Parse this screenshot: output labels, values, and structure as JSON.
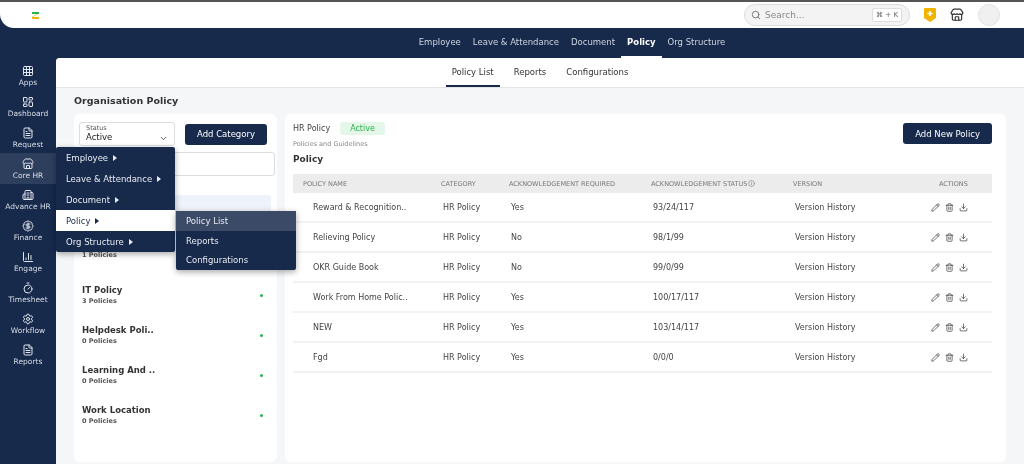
{
  "header": {
    "search": {
      "placeholder": "Search..."
    },
    "shortcut": "⌘ + K"
  },
  "top_nav": [
    {
      "label": "Employee",
      "selected": false
    },
    {
      "label": "Leave & Attendance",
      "selected": false
    },
    {
      "label": "Document",
      "selected": false
    },
    {
      "label": "Policy",
      "selected": true
    },
    {
      "label": "Org Structure",
      "selected": false
    }
  ],
  "sidebar": {
    "items": [
      {
        "kind": "apps",
        "label": "Apps",
        "selected": false
      },
      {
        "kind": "dashboard",
        "label": "Dashboard",
        "selected": false
      },
      {
        "kind": "request",
        "label": "Request",
        "selected": false
      },
      {
        "kind": "corehr",
        "label": "Core HR",
        "selected": true
      },
      {
        "kind": "advancehr",
        "label": "Advance HR",
        "selected": false
      },
      {
        "kind": "finance",
        "label": "Finance",
        "selected": false
      },
      {
        "kind": "engage",
        "label": "Engage",
        "selected": false
      },
      {
        "kind": "timesheet",
        "label": "Timesheet",
        "selected": false
      },
      {
        "kind": "workflow",
        "label": "Workflow",
        "selected": false
      },
      {
        "kind": "reports",
        "label": "Reports",
        "selected": false
      }
    ]
  },
  "sub_tabs": [
    {
      "label": "Policy List",
      "selected": true
    },
    {
      "label": "Reports",
      "selected": false
    },
    {
      "label": "Configurations",
      "selected": false
    }
  ],
  "page_title": "Organisation Policy",
  "categories_panel": {
    "status": {
      "label": "Status",
      "value": "Active"
    },
    "add_button": "Add Category",
    "items": [
      {
        "selected": true
      },
      {
        "count": "1 Policies",
        "selected": false
      },
      {
        "name": "IT Policy",
        "count": "3 Policies",
        "selected": false
      },
      {
        "name": "Helpdesk Poli..",
        "count": "0 Policies",
        "selected": false
      },
      {
        "name": "Learning And ..",
        "count": "0 Policies",
        "selected": false
      },
      {
        "name": "Work Location",
        "count": "0 Policies",
        "selected": false
      }
    ]
  },
  "policy_panel": {
    "category": "HR Policy",
    "status": "Active",
    "subtitle": "Policies and Guidelines",
    "heading": "Policy",
    "add_button": "Add New Policy",
    "table": {
      "columns": [
        "POLICY NAME",
        "CATEGORY",
        "ACKNOWLEDGEMENT REQUIRED",
        "ACKNOWLEDGEMENT STATUS",
        "VERSION",
        "ACTIONS"
      ],
      "rows": [
        [
          "Reward & Recognition..",
          "HR Policy",
          "Yes",
          "93/24/117",
          "Version History"
        ],
        [
          "Relieving Policy",
          "HR Policy",
          "No",
          "98/1/99",
          "Version History"
        ],
        [
          "OKR Guide Book",
          "HR Policy",
          "No",
          "99/0/99",
          "Version History"
        ],
        [
          "Work From Home Polic..",
          "HR Policy",
          "Yes",
          "100/17/117",
          "Version History"
        ],
        [
          "NEW",
          "HR Policy",
          "Yes",
          "103/14/117",
          "Version History"
        ],
        [
          "Fgd",
          "HR Policy",
          "Yes",
          "0/0/0",
          "Version History"
        ]
      ]
    }
  },
  "flyout_menu": {
    "items": [
      {
        "label": "Employee",
        "selected": false
      },
      {
        "label": "Leave & Attendance",
        "selected": false
      },
      {
        "label": "Document",
        "selected": false
      },
      {
        "label": "Policy",
        "selected": true
      },
      {
        "label": "Org Structure",
        "selected": false
      }
    ],
    "submenu": [
      {
        "label": "Policy List",
        "selected": true
      },
      {
        "label": "Reports",
        "selected": false
      },
      {
        "label": "Configurations",
        "selected": false
      }
    ]
  }
}
